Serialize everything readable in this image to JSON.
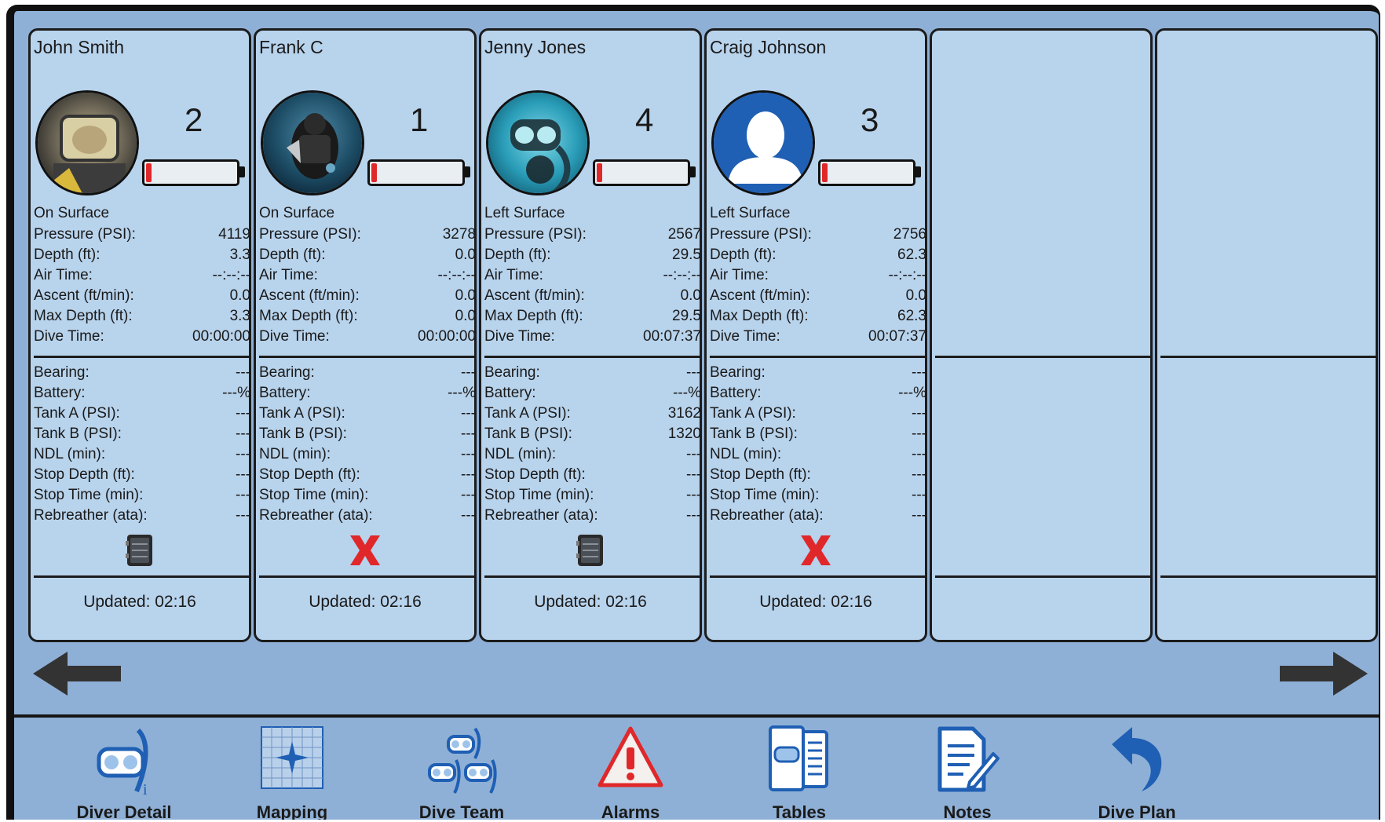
{
  "colors": {
    "panel": "#b8d3ec",
    "background": "#8fb0d6",
    "accent_blue": "#1f5fb4",
    "battery_red": "#e0282b",
    "alarm_red": "#e0282b"
  },
  "field_labels": {
    "pressure": "Pressure (PSI):",
    "depth": "Depth (ft):",
    "air_time": "Air Time:",
    "ascent": "Ascent (ft/min):",
    "max_depth": "Max Depth (ft):",
    "dive_time": "Dive Time:",
    "bearing": "Bearing:",
    "battery": "Battery:",
    "tank_a": "Tank A (PSI):",
    "tank_b": "Tank B (PSI):",
    "ndl": "NDL (min):",
    "stop_depth": "Stop Depth (ft):",
    "stop_time": "Stop Time (min):",
    "rebreather": "Rebreather (ata):"
  },
  "divers": [
    {
      "name": "John Smith",
      "number": "2",
      "avatar": "diver-photo-helmet",
      "battery_level": 0.06,
      "status": "On Surface",
      "pressure": "4119",
      "depth": "3.3",
      "air_time": "--:--:--",
      "ascent": "0.0",
      "max_depth": "3.3",
      "dive_time": "00:00:00",
      "bearing": "---",
      "battery": "---%",
      "tank_a": "---",
      "tank_b": "---",
      "ndl": "---",
      "stop_depth": "---",
      "stop_time": "---",
      "rebreather": "---",
      "connection_icon": "transmitter-icon",
      "updated": "Updated: 02:16"
    },
    {
      "name": "Frank C",
      "number": "1",
      "avatar": "diver-photo-underwater",
      "battery_level": 0.06,
      "status": "On Surface",
      "pressure": "3278",
      "depth": "0.0",
      "air_time": "--:--:--",
      "ascent": "0.0",
      "max_depth": "0.0",
      "dive_time": "00:00:00",
      "bearing": "---",
      "battery": "---%",
      "tank_a": "---",
      "tank_b": "---",
      "ndl": "---",
      "stop_depth": "---",
      "stop_time": "---",
      "rebreather": "---",
      "connection_icon": "no-connection-x-icon",
      "updated": "Updated: 02:16"
    },
    {
      "name": "Jenny Jones",
      "number": "4",
      "avatar": "diver-photo-mask",
      "battery_level": 0.06,
      "status": "Left Surface",
      "pressure": "2567",
      "depth": "29.5",
      "air_time": "--:--:--",
      "ascent": "0.0",
      "max_depth": "29.5",
      "dive_time": "00:07:37",
      "bearing": "---",
      "battery": "---%",
      "tank_a": "3162",
      "tank_b": "1320",
      "ndl": "---",
      "stop_depth": "---",
      "stop_time": "---",
      "rebreather": "---",
      "connection_icon": "transmitter-icon",
      "updated": "Updated: 02:16"
    },
    {
      "name": "Craig Johnson",
      "number": "3",
      "avatar": "default-user-avatar",
      "battery_level": 0.06,
      "status": "Left Surface",
      "pressure": "2756",
      "depth": "62.3",
      "air_time": "--:--:--",
      "ascent": "0.0",
      "max_depth": "62.3",
      "dive_time": "00:07:37",
      "bearing": "---",
      "battery": "---%",
      "tank_a": "---",
      "tank_b": "---",
      "ndl": "---",
      "stop_depth": "---",
      "stop_time": "---",
      "rebreather": "---",
      "connection_icon": "no-connection-x-icon",
      "updated": "Updated: 02:16"
    }
  ],
  "empty_slots": 2,
  "navigation": {
    "prev_icon": "arrow-left-icon",
    "next_icon": "arrow-right-icon"
  },
  "tabs": [
    {
      "label": "Diver Detail",
      "icon": "diver-mask-info-icon"
    },
    {
      "label": "Mapping",
      "icon": "compass-grid-icon"
    },
    {
      "label": "Dive Team",
      "icon": "dive-team-masks-icon"
    },
    {
      "label": "Alarms",
      "icon": "warning-triangle-icon"
    },
    {
      "label": "Tables",
      "icon": "dive-tables-icon"
    },
    {
      "label": "Notes",
      "icon": "notes-pencil-icon"
    },
    {
      "label": "Dive Plan",
      "icon": "return-arrow-icon"
    }
  ]
}
